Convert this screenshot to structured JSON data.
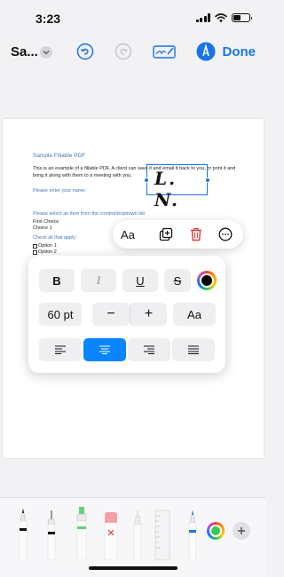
{
  "status": {
    "time": "3:23"
  },
  "toolbar": {
    "title": "Sa...",
    "done_label": "Done"
  },
  "colors": {
    "accent": "#1a73e8",
    "active_align": "#0a84ff",
    "delete": "#e53935",
    "selected_color": "#000000"
  },
  "document": {
    "title": "Sample Fillable PDF",
    "body": "This is an example of a fillable PDF. A client can save it and email it back to you, or print it and bring it along with them to a meeting with you.",
    "enter_name": "Please enter your name:",
    "select_label": "Please select an item from the combo/dropdown list.",
    "first_choice": "First Choice",
    "choice_value": "Choice 1",
    "check_all": "Check all that apply:",
    "options": [
      "Option 1",
      "Option 2"
    ],
    "signature": "L. N."
  },
  "context_menu": {
    "text_style_label": "Aa",
    "icons": [
      "duplicate-icon",
      "trash-icon",
      "more-icon"
    ]
  },
  "format_panel": {
    "styles": [
      "B",
      "I",
      "U",
      "S"
    ],
    "font_size": "60 pt",
    "decrease": "−",
    "increase": "+",
    "font_label": "Aa",
    "alignments": [
      "align-left-icon",
      "align-center-icon",
      "align-right-icon",
      "justify-icon"
    ],
    "active_alignment": "align-center-icon"
  },
  "tools": [
    "pen-tool",
    "fineliner-tool",
    "highlighter-tool",
    "eraser-tool",
    "pencil-tool",
    "ruler-tool",
    "marker-tool",
    "color-picker",
    "add-tool"
  ]
}
